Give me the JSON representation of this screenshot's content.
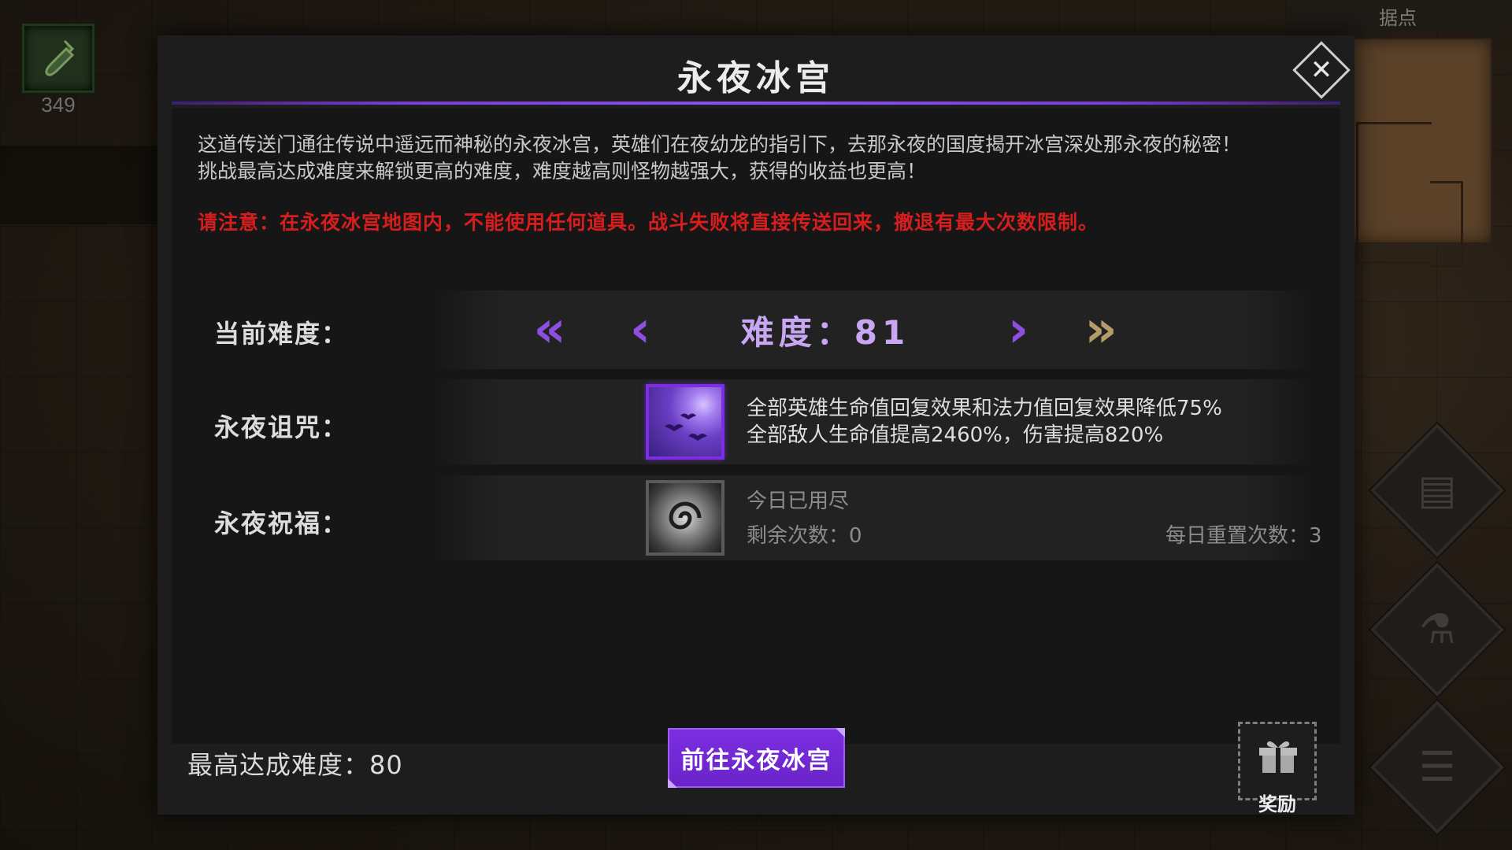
{
  "hud": {
    "item_count": "349",
    "minimap_title": "据点"
  },
  "dialog": {
    "title": "永夜冰宫",
    "description_line1": "这道传送门通往传说中遥远而神秘的永夜冰宫，英雄们在夜幼龙的指引下，去那永夜的国度揭开冰宫深处那永夜的秘密！",
    "description_line2": "挑战最高达成难度来解锁更高的难度，难度越高则怪物越强大，获得的收益也更高！",
    "warning": "请注意：在永夜冰宫地图内，不能使用任何道具。战斗失败将直接传送回来，撤退有最大次数限制。",
    "difficulty": {
      "label": "当前难度：",
      "value_text": "难度：81",
      "first_icon": "double-chevron-left-icon",
      "prev_icon": "chevron-left-icon",
      "next_icon": "chevron-right-icon",
      "last_icon": "double-chevron-right-icon"
    },
    "curse": {
      "label": "永夜诅咒：",
      "effect_line1": "全部英雄生命值回复效果和法力值回复效果降低75%",
      "effect_line2": "全部敌人生命值提高2460%，伤害提高820%"
    },
    "blessing": {
      "label": "永夜祝福：",
      "status": "今日已用尽",
      "remaining": "剩余次数：0",
      "daily_reset": "每日重置次数：3"
    },
    "best_difficulty": "最高达成难度：80",
    "go_button": "前往永夜冰宫",
    "reward_label": "奖励"
  },
  "colors": {
    "accent_purple": "#7b2ee0",
    "warning_red": "#d71e1e",
    "difficulty_text": "#c8a6f2",
    "gold_arrow": "#b59b6a"
  }
}
